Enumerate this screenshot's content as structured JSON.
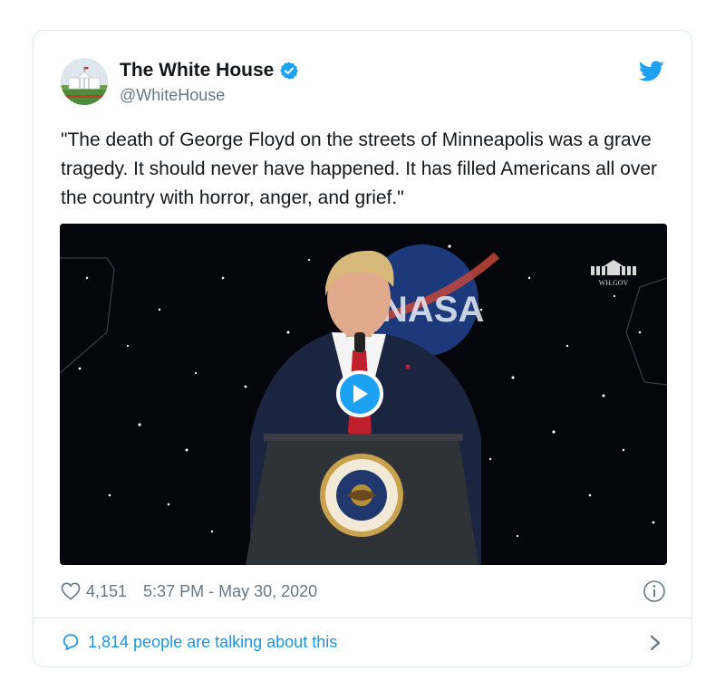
{
  "account": {
    "name": "The White House",
    "handle": "@WhiteHouse",
    "verified": true
  },
  "tweet": {
    "text": "\"The death of George Floyd on the streets of Minneapolis was a grave tragedy. It should never have happened. It has filled Americans all over the country with horror, anger, and grief.\""
  },
  "media": {
    "type": "video",
    "watermark": "WH.GOV",
    "backdrop_logo": "NASA",
    "icon": "play-icon"
  },
  "stats": {
    "likes": "4,151",
    "timestamp": "5:37 PM - May 30, 2020"
  },
  "footer": {
    "talking": "1,814 people are talking about this"
  },
  "colors": {
    "twitter_blue": "#1da1f2",
    "link_blue": "#1b95e0",
    "text": "#14171a",
    "muted": "#657786",
    "border": "#e1e8ed"
  },
  "icons": [
    "twitter-bird-icon",
    "verified-badge-icon",
    "heart-icon",
    "info-icon",
    "reply-bubble-icon",
    "chevron-right-icon",
    "play-icon"
  ]
}
